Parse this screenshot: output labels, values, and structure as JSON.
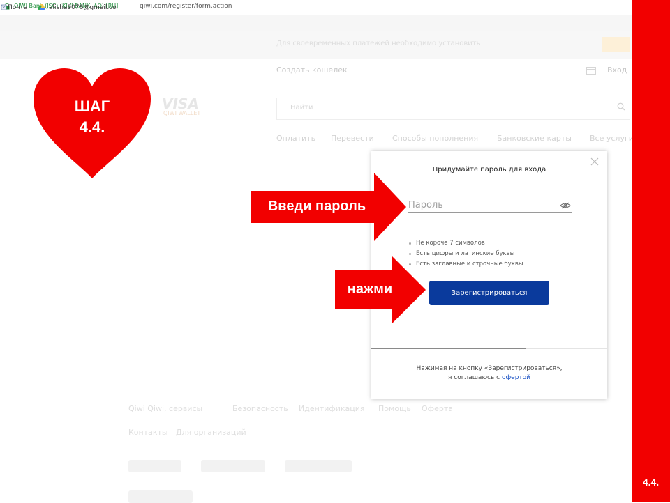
{
  "browser": {
    "ev_label": "QIWI Bank (JSC) (KIVI BANK, AO) [RU]",
    "url": "qiwi.com/register/form.action",
    "bookmarks": [
      {
        "label": "Почта"
      },
      {
        "label": "alisha9076@gmail.co"
      }
    ]
  },
  "site": {
    "notice_text": "Для своевременных платежей необходимо установить",
    "create_wallet": "Создать кошелек",
    "login": "Вход",
    "logo": "VISA",
    "logo_sub": "QIWI WALLET",
    "search_placeholder": "Найти",
    "nav": [
      "Оплатить",
      "Перевести",
      "Способы пополнения",
      "Банковские карты",
      "Все услуги"
    ],
    "footer_row1": [
      "Qiwi Qiwi, сервисы",
      "Безопасность",
      "Идентификация",
      "Помощь",
      "Оферта"
    ],
    "footer_row2": [
      "Контакты",
      "Для организаций"
    ]
  },
  "modal": {
    "title": "Придумайте пароль для входа",
    "password_placeholder": "Пароль",
    "requirements": [
      "Не короче 7 символов",
      "Есть цифры и латинские буквы",
      "Есть заглавные и строчные буквы"
    ],
    "register_label": "Зарегистрироваться",
    "agreement_line1": "Нажимая на кнопку «Зарегистрироваться»,",
    "agreement_line2_prefix": "я соглашаюсь с ",
    "offer_link": "офертой"
  },
  "annotations": {
    "step_line1": "ШАГ",
    "step_line2": "4.4.",
    "arrow_password": "Введи пароль",
    "arrow_click": "нажми",
    "side_label": "4.4."
  },
  "colors": {
    "accent_red": "#f20000",
    "primary_button": "#0a3a9c",
    "link": "#1a52c4"
  }
}
